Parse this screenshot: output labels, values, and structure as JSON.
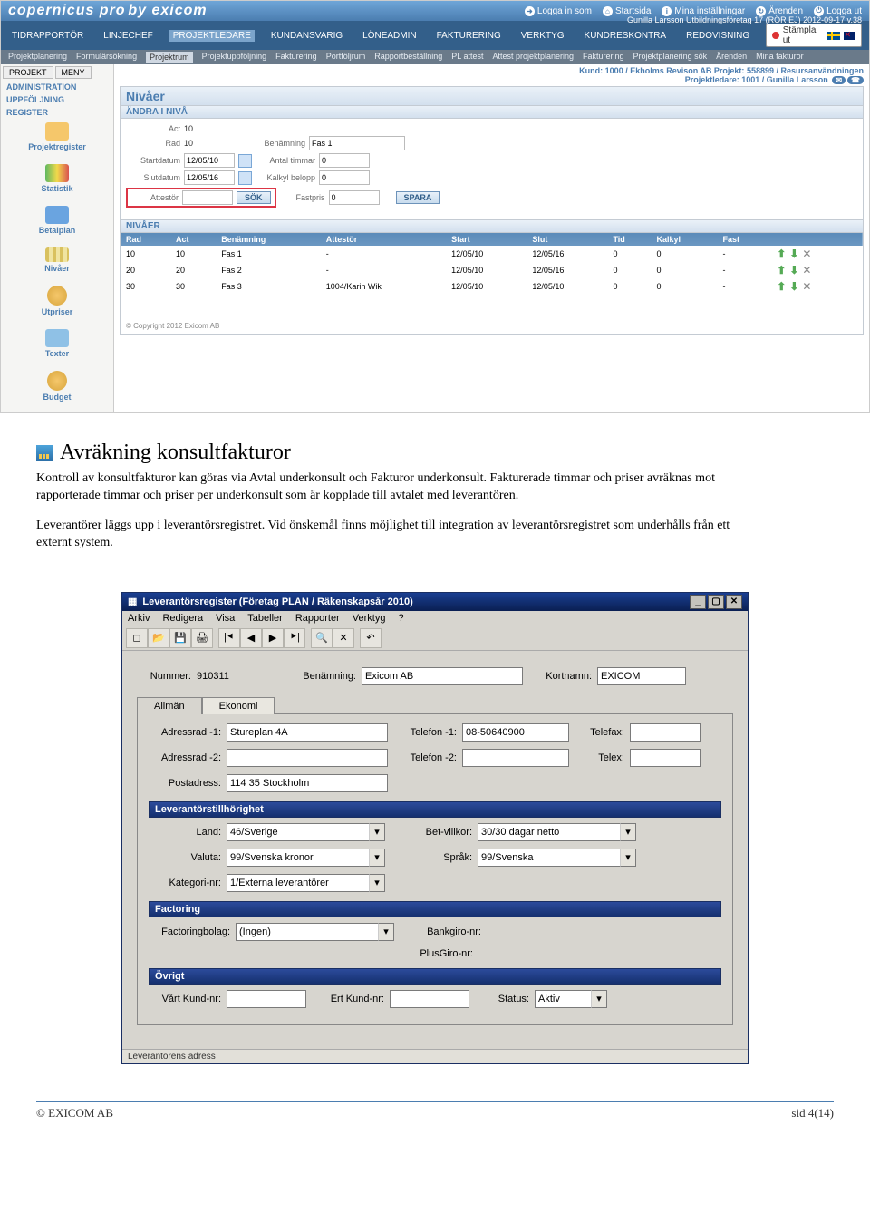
{
  "app": {
    "logo_main": "copernicus pro",
    "logo_sub": "by exicom",
    "top_links": {
      "login": "Logga in som",
      "home": "Startsida",
      "settings": "Mina inställningar",
      "cases": "Ärenden",
      "logout": "Logga ut"
    },
    "user_line": "Gunilla Larsson  Utbildningsföretag 17 (RÖR EJ)   2012-09-17  v.38",
    "main_tabs": [
      "TIDRAPPORTÖR",
      "LINJECHEF",
      "PROJEKTLEDARE",
      "KUNDANSVARIG",
      "LÖNEADMIN",
      "FAKTURERING",
      "VERKTYG",
      "KUNDRESKONTRA",
      "REDOVISNING"
    ],
    "main_tab_active": 2,
    "stampla": "Stämpla ut",
    "sub_tabs": [
      "Projektplanering",
      "Formulärsökning",
      "Projektrum",
      "Projektuppföljning",
      "Fakturering",
      "Portföljrum",
      "Rapportbeställning",
      "PL attest",
      "Attest projektplanering",
      "Fakturering",
      "Projektplanering sök",
      "Ärenden",
      "Mina fakturor"
    ],
    "sub_tab_active": 2,
    "context_tabs": [
      "PROJEKT",
      "MENY"
    ],
    "side_sections": [
      "ADMINISTRATION",
      "UPPFÖLJNING",
      "REGISTER"
    ],
    "side_items": [
      "Projektregister",
      "Statistik",
      "Betalplan",
      "Nivåer",
      "Utpriser",
      "Texter",
      "Budget"
    ],
    "kund_line": {
      "kund_lbl": "Kund:",
      "kund_val": "1000 / Ekholms Revison AB",
      "proj_lbl": "Projekt:",
      "proj_val": "558899 / Resursanvändningen",
      "pl_lbl": "Projektledare:",
      "pl_val": "1001 / Gunilla Larsson"
    },
    "panel_title": "Nivåer",
    "panel_sub": "ÄNDRA I NIVÅ",
    "form": {
      "act_lbl": "Act",
      "act_val": "10",
      "rad_lbl": "Rad",
      "rad_val": "10",
      "ben_lbl": "Benämning",
      "ben_val": "Fas 1",
      "start_lbl": "Startdatum",
      "start_val": "12/05/10",
      "timmar_lbl": "Antal timmar",
      "timmar_val": "0",
      "slut_lbl": "Slutdatum",
      "slut_val": "12/05/16",
      "kalk_lbl": "Kalkyl belopp",
      "kalk_val": "0",
      "attest_lbl": "Attestör",
      "attest_val": "",
      "sok": "SÖK",
      "fast_lbl": "Fastpris",
      "fast_val": "0",
      "spara": "SPARA"
    },
    "niv_head": "NIVÅER",
    "cols": [
      "Rad",
      "Act",
      "Benämning",
      "Attestör",
      "Start",
      "Slut",
      "Tid",
      "Kalkyl",
      "Fast"
    ],
    "rows": [
      {
        "rad": "10",
        "act": "10",
        "ben": "Fas 1",
        "att": "-",
        "start": "12/05/10",
        "slut": "12/05/16",
        "tid": "0",
        "kalk": "0",
        "fast": "-"
      },
      {
        "rad": "20",
        "act": "20",
        "ben": "Fas 2",
        "att": "-",
        "start": "12/05/10",
        "slut": "12/05/16",
        "tid": "0",
        "kalk": "0",
        "fast": "-"
      },
      {
        "rad": "30",
        "act": "30",
        "ben": "Fas 3",
        "att": "1004/Karin Wik",
        "start": "12/05/10",
        "slut": "12/05/10",
        "tid": "0",
        "kalk": "0",
        "fast": "-"
      }
    ],
    "copyright": "© Copyright 2012 Exicom AB"
  },
  "article": {
    "title": "Avräkning konsultfakturor",
    "p1": "Kontroll av konsultfakturor kan göras via Avtal underkonsult och Fakturor underkonsult. Fakturerade timmar och priser avräknas mot rapporterade timmar och priser per underkonsult som är kopplade till avtalet med leverantören.",
    "p2": "Leverantörer läggs upp i leverantörsregistret. Vid önskemål finns möjlighet till integration av leverantörsregistret som underhålls från ett externt system."
  },
  "win": {
    "title": "Leverantörsregister (Företag PLAN / Räkenskapsår 2010)",
    "menu": [
      "Arkiv",
      "Redigera",
      "Visa",
      "Tabeller",
      "Rapporter",
      "Verktyg",
      "?"
    ],
    "toolbar": [
      "◻",
      "📂",
      "💾",
      "🖨",
      "|⯇",
      "◀",
      "▶",
      "⯈|",
      "🔍",
      "✕",
      "↶"
    ],
    "num_lbl": "Nummer:",
    "num_val": "910311",
    "ben_lbl": "Benämning:",
    "ben_val": "Exicom AB",
    "kort_lbl": "Kortnamn:",
    "kort_val": "EXICOM",
    "tabs": [
      "Allmän",
      "Ekonomi"
    ],
    "adr1_lbl": "Adressrad -1:",
    "adr1_val": "Stureplan 4A",
    "adr2_lbl": "Adressrad -2:",
    "adr2_val": "",
    "post_lbl": "Postadress:",
    "post_val": "114 35 Stockholm",
    "tel1_lbl": "Telefon -1:",
    "tel1_val": "08-50640900",
    "tel2_lbl": "Telefon -2:",
    "tel2_val": "",
    "fax_lbl": "Telefax:",
    "fax_val": "",
    "tlx_lbl": "Telex:",
    "tlx_val": "",
    "grp1": "Leverantörstillhörighet",
    "land_lbl": "Land:",
    "land_val": "46/Sverige",
    "val_lbl": "Valuta:",
    "val_val": "99/Svenska kronor",
    "kat_lbl": "Kategori-nr:",
    "kat_val": "1/Externa leverantörer",
    "bet_lbl": "Bet-villkor:",
    "bet_val": "30/30 dagar netto",
    "spr_lbl": "Språk:",
    "spr_val": "99/Svenska",
    "grp2": "Factoring",
    "fact_lbl": "Factoringbolag:",
    "fact_val": "(Ingen)",
    "bg_lbl": "Bankgiro-nr:",
    "bg_val": "",
    "pg_lbl": "PlusGiro-nr:",
    "pg_val": "",
    "grp3": "Övrigt",
    "vk_lbl": "Vårt Kund-nr:",
    "vk_val": "",
    "ek_lbl": "Ert Kund-nr:",
    "ek_val": "",
    "st_lbl": "Status:",
    "st_val": "Aktiv",
    "statusbar": "Leverantörens adress"
  },
  "footer": {
    "left": "© EXICOM AB",
    "right": "sid 4(14)"
  }
}
